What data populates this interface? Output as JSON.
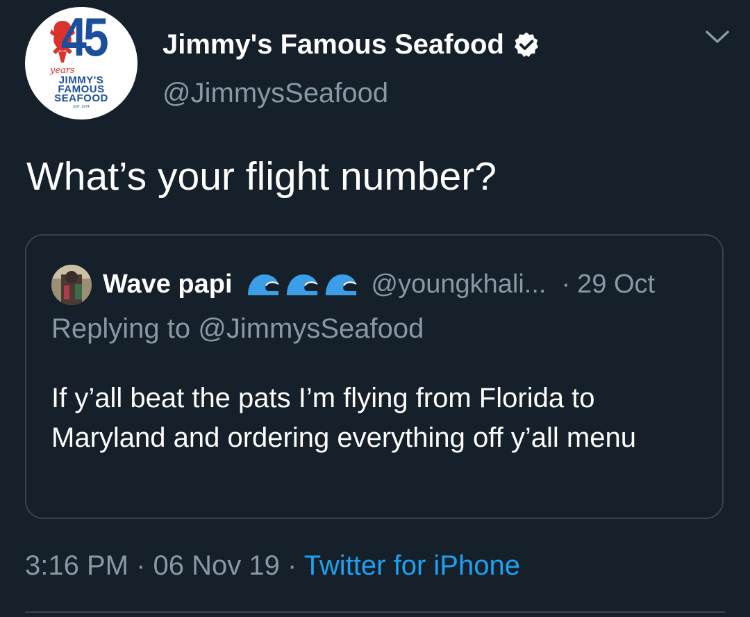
{
  "author": {
    "display_name": "Jimmy's Famous Seafood",
    "handle": "@JimmysSeafood",
    "verified": true,
    "avatar": {
      "number": "45",
      "years": "years",
      "brand_line1": "JIMMY'S",
      "brand_line2": "FAMOUS",
      "brand_line3": "SEAFOOD",
      "est": "EST. 1974"
    }
  },
  "tweet": {
    "text": "What’s your flight number?"
  },
  "quoted_tweet": {
    "display_name": "Wave papi",
    "emoji": [
      "water-wave-icon",
      "water-wave-icon",
      "water-wave-icon"
    ],
    "handle": "@youngkhali...",
    "separator": "·",
    "date": "29 Oct",
    "replying_to": "Replying to @JimmysSeafood",
    "text": "If y’all beat the pats I’m flying from Florida to Maryland and ordering everything off y’all menu"
  },
  "meta": {
    "time": "3:16 PM",
    "sep1": " · ",
    "date": "06 Nov 19",
    "sep2": " · ",
    "source": "Twitter for iPhone"
  },
  "colors": {
    "background": "#15202b",
    "text": "#ffffff",
    "secondary_text": "#8899a6",
    "link": "#1da1f2",
    "border": "#38444d",
    "wave_emoji": "#3b9ee6"
  }
}
